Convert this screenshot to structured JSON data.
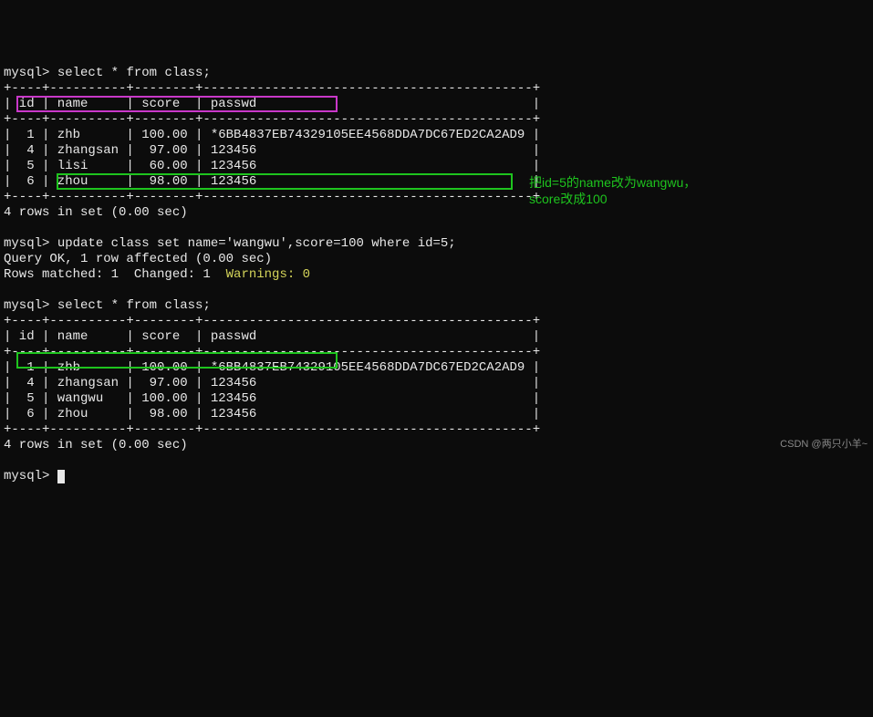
{
  "prompt": "mysql>",
  "q1": {
    "cmd": "select * from class;",
    "sep_full": "+----+----------+--------+-------------------------------------------+",
    "hdr": "| id | name     | score  | passwd                                    |",
    "r1": "|  1 | zhb      | 100.00 | *6BB4837EB74329105EE4568DDA7DC67ED2CA2AD9 |",
    "r2": "|  4 | zhangsan |  97.00 | 123456                                    |",
    "r3": "|  5 | lisi     |  60.00 | 123456                                    |",
    "r4": "|  6 | zhou     |  98.00 | 123456                                    |",
    "footer": "4 rows in set (0.00 sec)"
  },
  "upd": {
    "cmd": "update class set name='wangwu',score=100 where id=5;",
    "l1": "Query OK, 1 row affected (0.00 sec)",
    "l2a": "Rows matched: 1  Changed: 1  ",
    "l2b": "Warnings: 0"
  },
  "q2": {
    "cmd": "select * from class;",
    "sep_full": "+----+----------+--------+-------------------------------------------+",
    "hdr": "| id | name     | score  | passwd                                    |",
    "r1": "|  1 | zhb      | 100.00 | *6BB4837EB74329105EE4568DDA7DC67ED2CA2AD9 |",
    "r2": "|  4 | zhangsan |  97.00 | 123456                                    |",
    "r3": "|  5 | wangwu   | 100.00 | 123456                                    |",
    "r4": "|  6 | zhou     |  98.00 | 123456                                    |",
    "footer": "4 rows in set (0.00 sec)"
  },
  "annotation": {
    "l1": "把id=5的name改为wangwu，",
    "l2": "score改成100"
  },
  "watermark": "CSDN @两只小羊~",
  "chart_data": {
    "type": "table",
    "before": {
      "columns": [
        "id",
        "name",
        "score",
        "passwd"
      ],
      "rows": [
        [
          1,
          "zhb",
          100.0,
          "*6BB4837EB74329105EE4568DDA7DC67ED2CA2AD9"
        ],
        [
          4,
          "zhangsan",
          97.0,
          "123456"
        ],
        [
          5,
          "lisi",
          60.0,
          "123456"
        ],
        [
          6,
          "zhou",
          98.0,
          "123456"
        ]
      ]
    },
    "update_sql": "update class set name='wangwu',score=100 where id=5;",
    "after": {
      "columns": [
        "id",
        "name",
        "score",
        "passwd"
      ],
      "rows": [
        [
          1,
          "zhb",
          100.0,
          "*6BB4837EB74329105EE4568DDA7DC67ED2CA2AD9"
        ],
        [
          4,
          "zhangsan",
          97.0,
          "123456"
        ],
        [
          5,
          "wangwu",
          100.0,
          "123456"
        ],
        [
          6,
          "zhou",
          98.0,
          "123456"
        ]
      ]
    }
  }
}
